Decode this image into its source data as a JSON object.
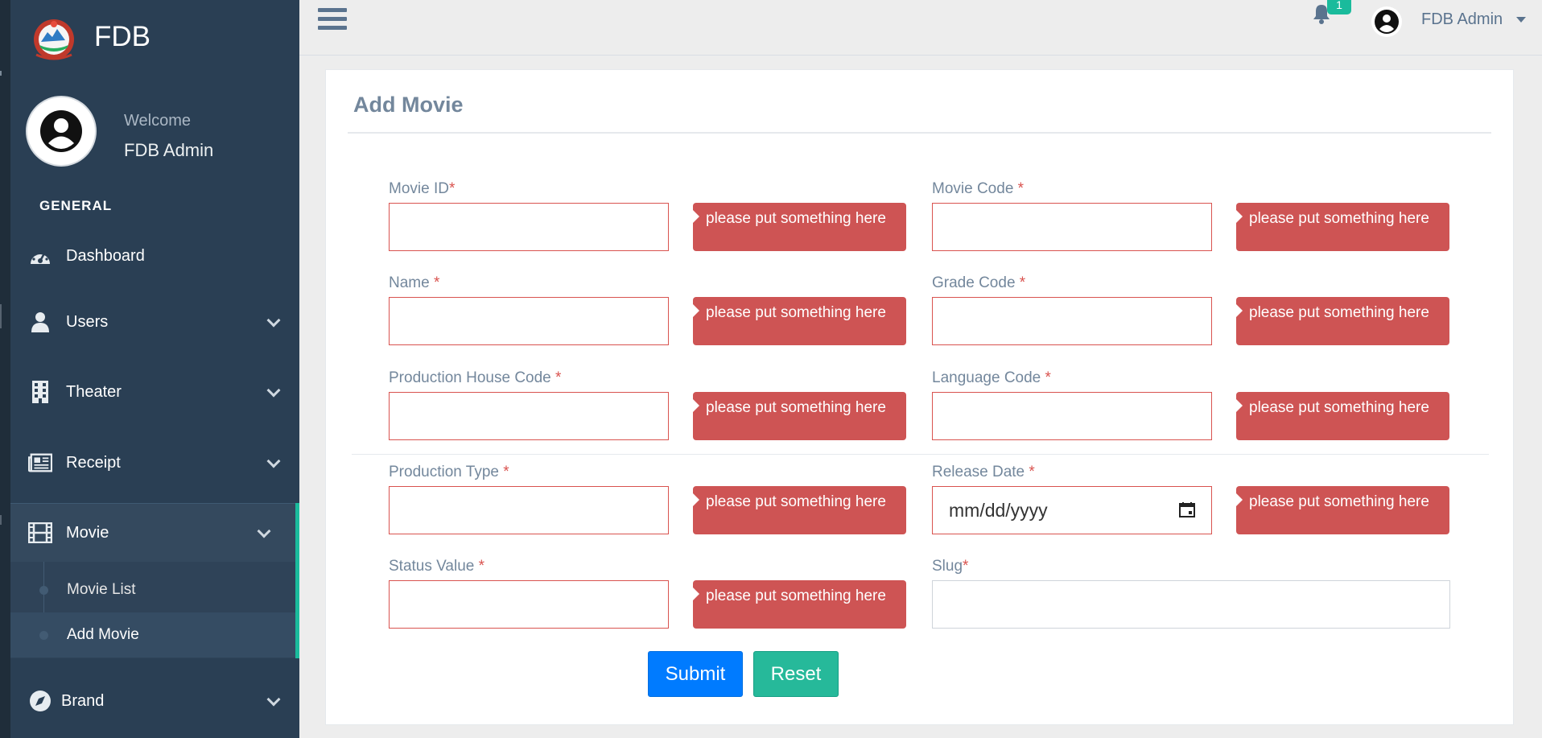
{
  "sidebar": {
    "brand": "FDB",
    "welcome": "Welcome",
    "user_name": "FDB Admin",
    "section": "GENERAL",
    "items": [
      {
        "label": "Dashboard"
      },
      {
        "label": "Users"
      },
      {
        "label": "Theater"
      },
      {
        "label": "Receipt"
      },
      {
        "label": "Movie"
      },
      {
        "label": "Brand"
      }
    ],
    "movie_sub": [
      {
        "label": "Movie List"
      },
      {
        "label": "Add Movie"
      }
    ]
  },
  "topbar": {
    "notification_count": "1",
    "user_name": "FDB Admin"
  },
  "form": {
    "title": "Add Movie",
    "required_mark": "*",
    "error_text": "please put something here",
    "fields": {
      "movie_id": "Movie ID",
      "movie_code": "Movie Code ",
      "name": "Name ",
      "grade_code": "Grade Code ",
      "production_house_code": "Production House Code ",
      "language_code": "Language Code ",
      "production_type": "Production Type ",
      "release_date": "Release Date ",
      "status_value": "Status Value ",
      "slug": "Slug"
    },
    "release_date_placeholder": "mm/dd/yyyy",
    "submit_label": "Submit",
    "reset_label": "Reset"
  },
  "colors": {
    "sidebar_bg": "#2a3f54",
    "accent": "#1abb9c",
    "error": "#d9534f",
    "submit": "#007bff",
    "reset": "#26b99a"
  }
}
